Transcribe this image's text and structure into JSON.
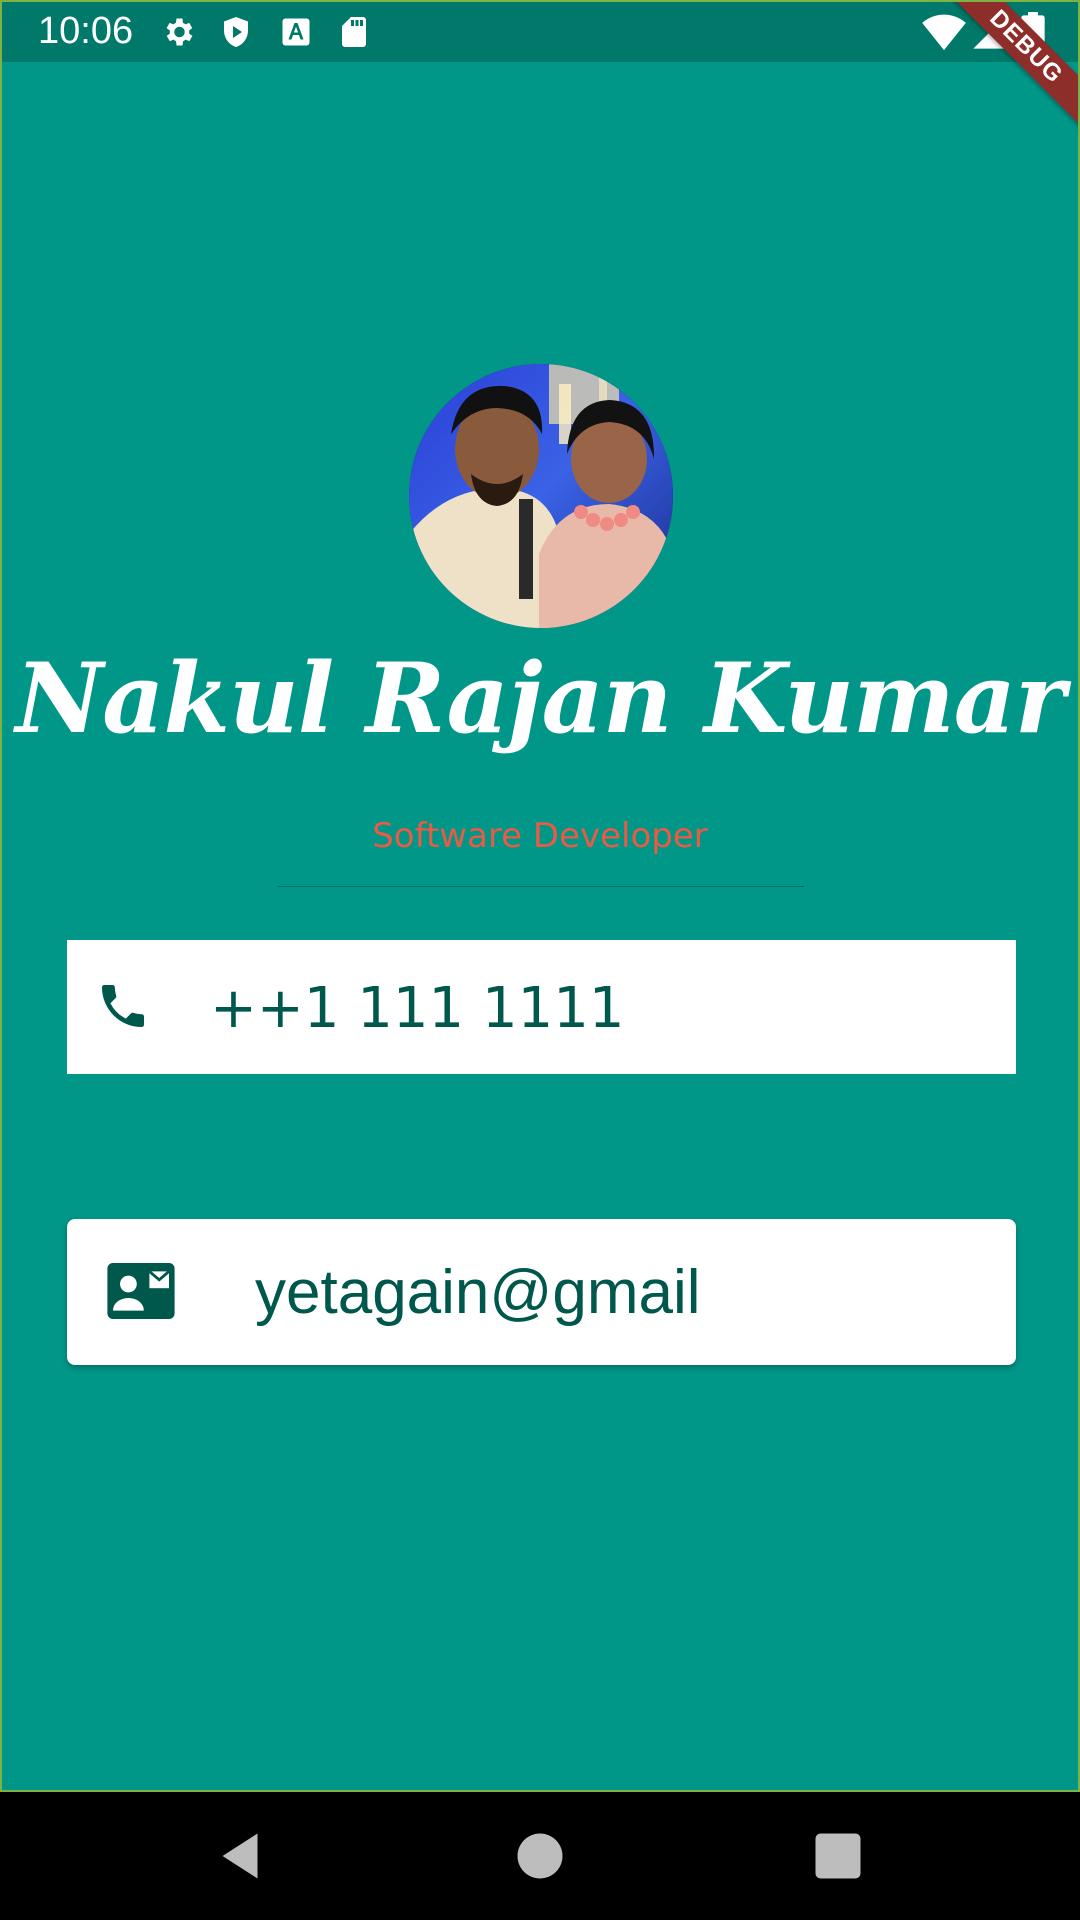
{
  "status_bar": {
    "time": "10:06",
    "icons": [
      "settings-icon",
      "shield-play-icon",
      "font-a-icon",
      "sd-card-icon"
    ],
    "right_icons": [
      "wifi-icon",
      "cell-signal-icon",
      "battery-icon"
    ],
    "debug_label": "DEBUG"
  },
  "profile": {
    "name": "Nakul Rajan Kumar",
    "title": "Software Developer",
    "avatar": "avatar-photo"
  },
  "contacts": {
    "phone": {
      "icon": "phone-icon",
      "value": "++1 111 1111"
    },
    "email": {
      "icon": "contact-mail-icon",
      "value": "yetagain@gmail"
    }
  },
  "navigation": {
    "buttons": [
      "back-icon",
      "home-icon",
      "recents-icon"
    ]
  },
  "colors": {
    "background": "#009688",
    "status_bar": "#00796b",
    "title_accent": "#e65c45",
    "card_text": "#00574b",
    "card_bg": "#ffffff"
  }
}
